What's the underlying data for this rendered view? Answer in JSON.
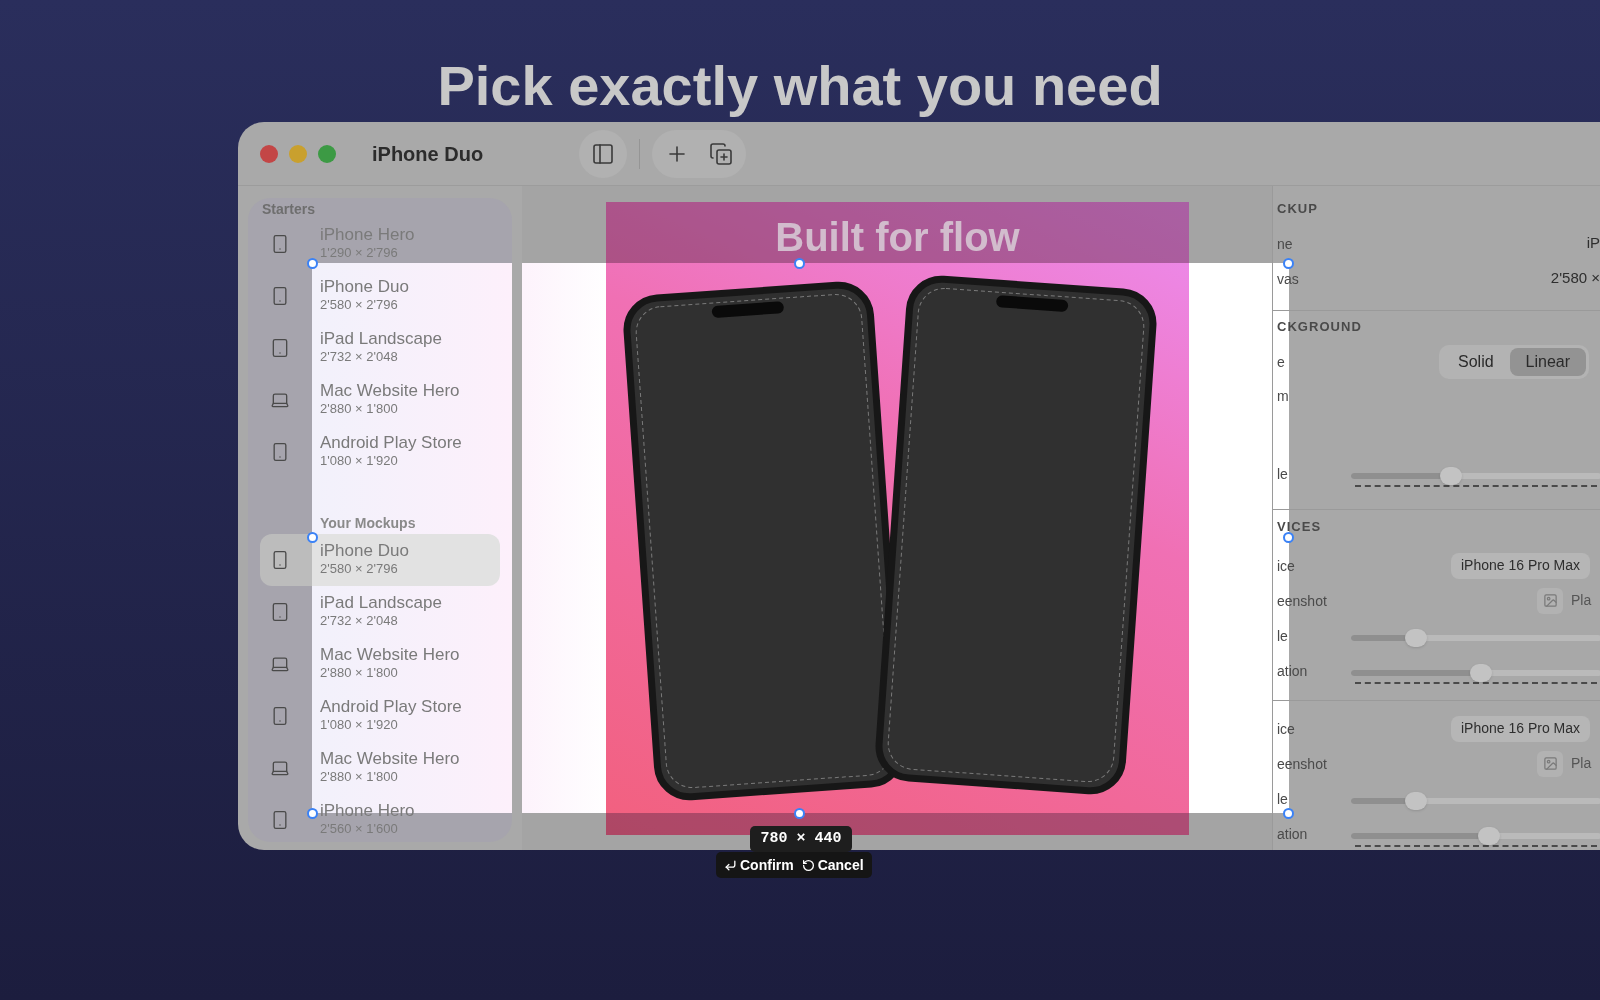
{
  "headline": "Pick exactly what you need",
  "window": {
    "title": "iPhone Duo"
  },
  "sidebar": {
    "sections": [
      {
        "title": "Starters",
        "items": [
          {
            "name": "iPhone Hero",
            "size": "1'290 × 2'796",
            "kind": "phone",
            "selected": false
          },
          {
            "name": "iPhone Duo",
            "size": "2'580 × 2'796",
            "kind": "phone",
            "selected": false
          },
          {
            "name": "iPad Landscape",
            "size": "2'732 × 2'048",
            "kind": "tablet",
            "selected": false
          },
          {
            "name": "Mac Website Hero",
            "size": "2'880 × 1'800",
            "kind": "laptop",
            "selected": false
          },
          {
            "name": "Android Play Store",
            "size": "1'080 × 1'920",
            "kind": "phone",
            "selected": false
          }
        ]
      },
      {
        "title": "Your Mockups",
        "items": [
          {
            "name": "iPhone Duo",
            "size": "2'580 × 2'796",
            "kind": "phone",
            "selected": true
          },
          {
            "name": "iPad Landscape",
            "size": "2'732 × 2'048",
            "kind": "tablet",
            "selected": false
          },
          {
            "name": "Mac Website Hero",
            "size": "2'880 × 1'800",
            "kind": "laptop",
            "selected": false
          },
          {
            "name": "Android Play Store",
            "size": "1'080 × 1'920",
            "kind": "phone",
            "selected": false
          },
          {
            "name": "Mac Website Hero",
            "size": "2'880 × 1'800",
            "kind": "laptop",
            "selected": false
          },
          {
            "name": "iPhone Hero",
            "size": "2'560 × 1'600",
            "kind": "phone",
            "selected": false
          }
        ]
      }
    ]
  },
  "canvas": {
    "poster_title": "Built for flow"
  },
  "selection": {
    "size": "780 × 440",
    "confirm": "Confirm",
    "cancel": "Cancel"
  },
  "inspector": [
    {
      "title": "CKUP",
      "rows": [
        {
          "kind": "value",
          "label": "ne",
          "value": "iP"
        },
        {
          "kind": "value",
          "label": "vas",
          "value": "2'580 ×"
        }
      ]
    },
    {
      "title": "CKGROUND",
      "rows": [
        {
          "kind": "segmented",
          "label": "e",
          "options": [
            {
              "label": "Solid",
              "selected": false
            },
            {
              "label": "Linear",
              "selected": true
            }
          ]
        },
        {
          "kind": "label",
          "label": "m"
        },
        {
          "kind": "slider",
          "label": "le",
          "level": 0.4,
          "ticks": true
        }
      ]
    },
    {
      "title": "VICES",
      "rows": [
        {
          "kind": "popup",
          "label": "ice",
          "value": "iPhone 16 Pro Max"
        },
        {
          "kind": "image",
          "label": "eenshot",
          "value": "Pla"
        },
        {
          "kind": "slider",
          "label": "le",
          "level": 0.26,
          "ticks": false
        },
        {
          "kind": "slider",
          "label": "ation",
          "level": 0.52,
          "ticks": true
        }
      ]
    },
    {
      "rows": [
        {
          "kind": "popup",
          "label": "ice",
          "value": "iPhone 16 Pro Max"
        },
        {
          "kind": "image",
          "label": "eenshot",
          "value": "Pla"
        },
        {
          "kind": "slider",
          "label": "le",
          "level": 0.26,
          "ticks": false
        },
        {
          "kind": "slider",
          "label": "ation",
          "level": 0.55,
          "ticks": true
        }
      ]
    }
  ]
}
